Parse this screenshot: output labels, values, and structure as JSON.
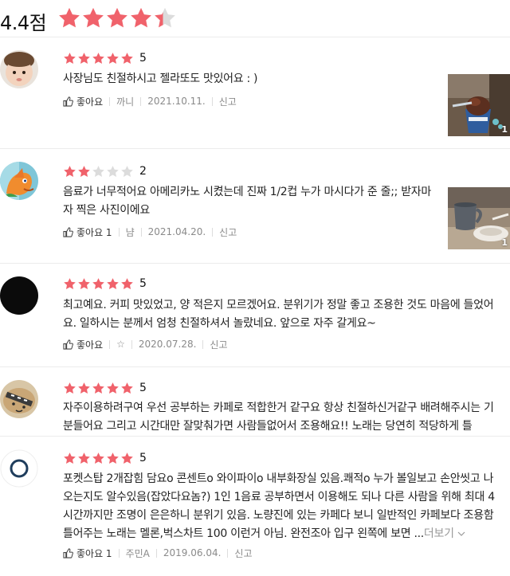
{
  "summary": {
    "score": "4.4점",
    "rating": 4.4
  },
  "colors": {
    "star_on": "#f0626b",
    "star_off": "#dcdcdc"
  },
  "reviews": [
    {
      "rating": 5,
      "rating_label": "5",
      "text": "사장님도 친절하시고 젤라또도 맛있어요 : )",
      "like_label": "좋아요",
      "author": "까니",
      "date": "2021.10.11.",
      "report": "신고",
      "photo_count": "1"
    },
    {
      "rating": 2,
      "rating_label": "2",
      "text": "음료가 너무적어요 아메리카노 시켰는데 진짜 1/2컵 누가 마시다가 준 줄;; 받자마자 찍은 사진이에요",
      "like_label": "좋아요 1",
      "author": "냠",
      "date": "2021.04.20.",
      "report": "신고",
      "photo_count": "1"
    },
    {
      "rating": 5,
      "rating_label": "5",
      "text": "최고예요. 커피 맛있었고, 양 적은지 모르겠어요.  분위기가 정말 좋고 조용한 것도 마음에 들었어요.  일하시는 분께서 엄청 친절하셔서 놀랐네요. 앞으로 자주 갈게요~",
      "like_label": "좋아요",
      "author": "☆",
      "date": "2020.07.28.",
      "report": "신고"
    },
    {
      "rating": 5,
      "rating_label": "5",
      "text": "자주이용하려구여 우선 공부하는 카페로 적합한거 같구요 항상 친절하신거같구 배려해주시는 기분들어요 그리고 시간대만 잘맞춰가면 사람들없어서 조용해요!! 노래는 당연히 적당하게 틀"
    },
    {
      "rating": 5,
      "rating_label": "5",
      "text": "포켓스탑 2개잡힘 담요o 콘센트o 와이파이o 내부화장실 있음.쾌적o 누가 볼일보고 손안씻고 나오는지도 알수있음(잡았다요놈?) 1인 1음료 공부하면서 이용해도 되나 다른 사람을 위해 최대 4시간까지만 조명이 은은하니 분위기 있음. 노량진에 있는 카페다 보니 일반적인 카페보다 조용함 틀어주는 노래는 멜론,벅스차트 100 이런거 아님. 완전조아 입구 왼쪽에 보면 ...",
      "more_label": "더보기",
      "like_label": "좋아요 1",
      "author": "주민A",
      "date": "2019.06.04.",
      "report": "신고"
    }
  ]
}
